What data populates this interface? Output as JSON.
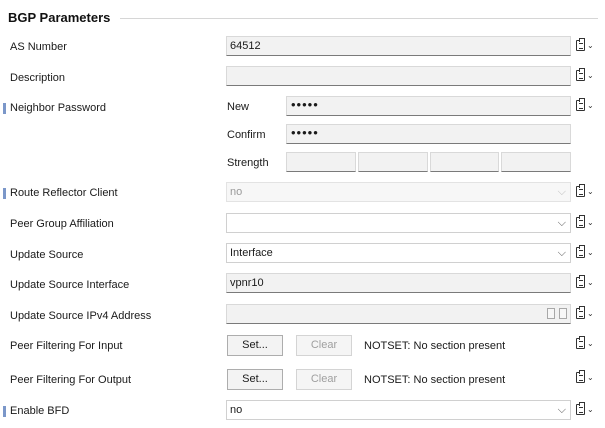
{
  "group": {
    "title": "BGP Parameters"
  },
  "rows": {
    "as_number": {
      "label": "AS Number",
      "value": "64512"
    },
    "description": {
      "label": "Description",
      "value": ""
    },
    "neighbor_password": {
      "label": "Neighbor Password",
      "new_label": "New",
      "new_value": "•••••",
      "confirm_label": "Confirm",
      "confirm_value": "•••••",
      "strength_label": "Strength"
    },
    "route_reflector_client": {
      "label": "Route Reflector Client",
      "value": "no"
    },
    "peer_group_affiliation": {
      "label": "Peer Group Affiliation",
      "value": ""
    },
    "update_source": {
      "label": "Update Source",
      "value": "Interface"
    },
    "update_source_interface": {
      "label": "Update Source Interface",
      "value": "vpnr10"
    },
    "update_source_ipv4": {
      "label": "Update Source IPv4 Address",
      "value": ""
    },
    "peer_filter_input": {
      "label": "Peer Filtering For Input",
      "set_label": "Set...",
      "clear_label": "Clear",
      "status": "NOTSET: No section present"
    },
    "peer_filter_output": {
      "label": "Peer Filtering For Output",
      "set_label": "Set...",
      "clear_label": "Clear",
      "status": "NOTSET: No section present"
    },
    "enable_bfd": {
      "label": "Enable BFD",
      "value": "no"
    }
  },
  "icons": {
    "clipboard": "clipboard-menu-icon",
    "chevron": "chevron-down-icon",
    "marker": "required-marker-icon"
  },
  "colors": {
    "marker": "#7b97c9",
    "field_bg": "#f2f2f2"
  }
}
